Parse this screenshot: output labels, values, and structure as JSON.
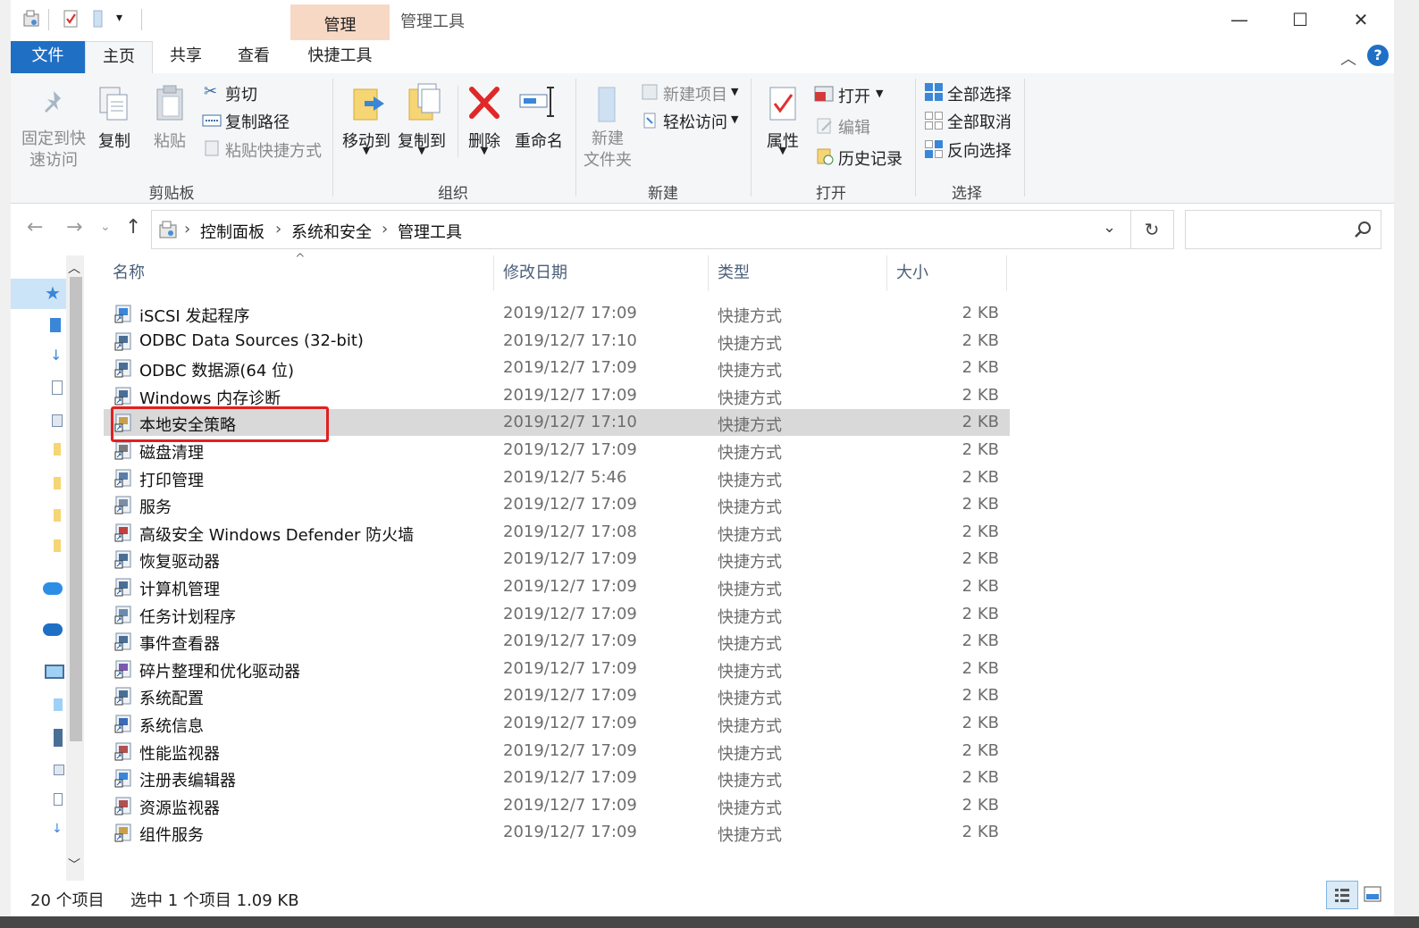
{
  "window": {
    "title": "管理工具",
    "context_tab": "管理",
    "controls": {
      "minimize": "—",
      "maximize": "☐",
      "close": "✕"
    }
  },
  "tabs": [
    "文件",
    "主页",
    "共享",
    "查看",
    "快捷工具"
  ],
  "ribbon": {
    "clipboard": {
      "pin": [
        "固定到快",
        "速访问"
      ],
      "copy": "复制",
      "paste": "粘贴",
      "cut": "剪切",
      "copy_path": "复制路径",
      "paste_shortcut": "粘贴快捷方式",
      "group": "剪贴板"
    },
    "organize": {
      "move_to": "移动到",
      "copy_to": "复制到",
      "delete": "删除",
      "rename": "重命名",
      "group": "组织"
    },
    "new": {
      "new_folder": [
        "新建",
        "文件夹"
      ],
      "new_item": "新建项目",
      "easy_access": "轻松访问",
      "group": "新建"
    },
    "open": {
      "properties": "属性",
      "open": "打开",
      "edit": "编辑",
      "history": "历史记录",
      "group": "打开"
    },
    "select": {
      "select_all": "全部选择",
      "select_none": "全部取消",
      "invert": "反向选择",
      "group": "选择"
    }
  },
  "address": {
    "crumbs": [
      "控制面板",
      "系统和安全",
      "管理工具"
    ],
    "search_placeholder": ""
  },
  "columns": [
    "名称",
    "修改日期",
    "类型",
    "大小"
  ],
  "files": [
    {
      "name": "iSCSI 发起程序",
      "date": "2019/12/7 17:09",
      "type": "快捷方式",
      "size": "2 KB"
    },
    {
      "name": "ODBC Data Sources (32-bit)",
      "date": "2019/12/7 17:10",
      "type": "快捷方式",
      "size": "2 KB"
    },
    {
      "name": "ODBC 数据源(64 位)",
      "date": "2019/12/7 17:09",
      "type": "快捷方式",
      "size": "2 KB"
    },
    {
      "name": "Windows 内存诊断",
      "date": "2019/12/7 17:09",
      "type": "快捷方式",
      "size": "2 KB"
    },
    {
      "name": "本地安全策略",
      "date": "2019/12/7 17:10",
      "type": "快捷方式",
      "size": "2 KB",
      "selected": true
    },
    {
      "name": "磁盘清理",
      "date": "2019/12/7 17:09",
      "type": "快捷方式",
      "size": "2 KB"
    },
    {
      "name": "打印管理",
      "date": "2019/12/7 5:46",
      "type": "快捷方式",
      "size": "2 KB"
    },
    {
      "name": "服务",
      "date": "2019/12/7 17:09",
      "type": "快捷方式",
      "size": "2 KB"
    },
    {
      "name": "高级安全 Windows Defender 防火墙",
      "date": "2019/12/7 17:08",
      "type": "快捷方式",
      "size": "2 KB"
    },
    {
      "name": "恢复驱动器",
      "date": "2019/12/7 17:09",
      "type": "快捷方式",
      "size": "2 KB"
    },
    {
      "name": "计算机管理",
      "date": "2019/12/7 17:09",
      "type": "快捷方式",
      "size": "2 KB"
    },
    {
      "name": "任务计划程序",
      "date": "2019/12/7 17:09",
      "type": "快捷方式",
      "size": "2 KB"
    },
    {
      "name": "事件查看器",
      "date": "2019/12/7 17:09",
      "type": "快捷方式",
      "size": "2 KB"
    },
    {
      "name": "碎片整理和优化驱动器",
      "date": "2019/12/7 17:09",
      "type": "快捷方式",
      "size": "2 KB"
    },
    {
      "name": "系统配置",
      "date": "2019/12/7 17:09",
      "type": "快捷方式",
      "size": "2 KB"
    },
    {
      "name": "系统信息",
      "date": "2019/12/7 17:09",
      "type": "快捷方式",
      "size": "2 KB"
    },
    {
      "name": "性能监视器",
      "date": "2019/12/7 17:09",
      "type": "快捷方式",
      "size": "2 KB"
    },
    {
      "name": "注册表编辑器",
      "date": "2019/12/7 17:09",
      "type": "快捷方式",
      "size": "2 KB"
    },
    {
      "name": "资源监视器",
      "date": "2019/12/7 17:09",
      "type": "快捷方式",
      "size": "2 KB"
    },
    {
      "name": "组件服务",
      "date": "2019/12/7 17:09",
      "type": "快捷方式",
      "size": "2 KB"
    }
  ],
  "status": {
    "count": "20 个项目",
    "selection": "选中 1 个项目  1.09 KB"
  },
  "colors": {
    "file_tab": "#1f6fc5",
    "context_tab": "#f7d8c4",
    "selection": "#d9d9d9",
    "highlight_box": "#e02020"
  }
}
